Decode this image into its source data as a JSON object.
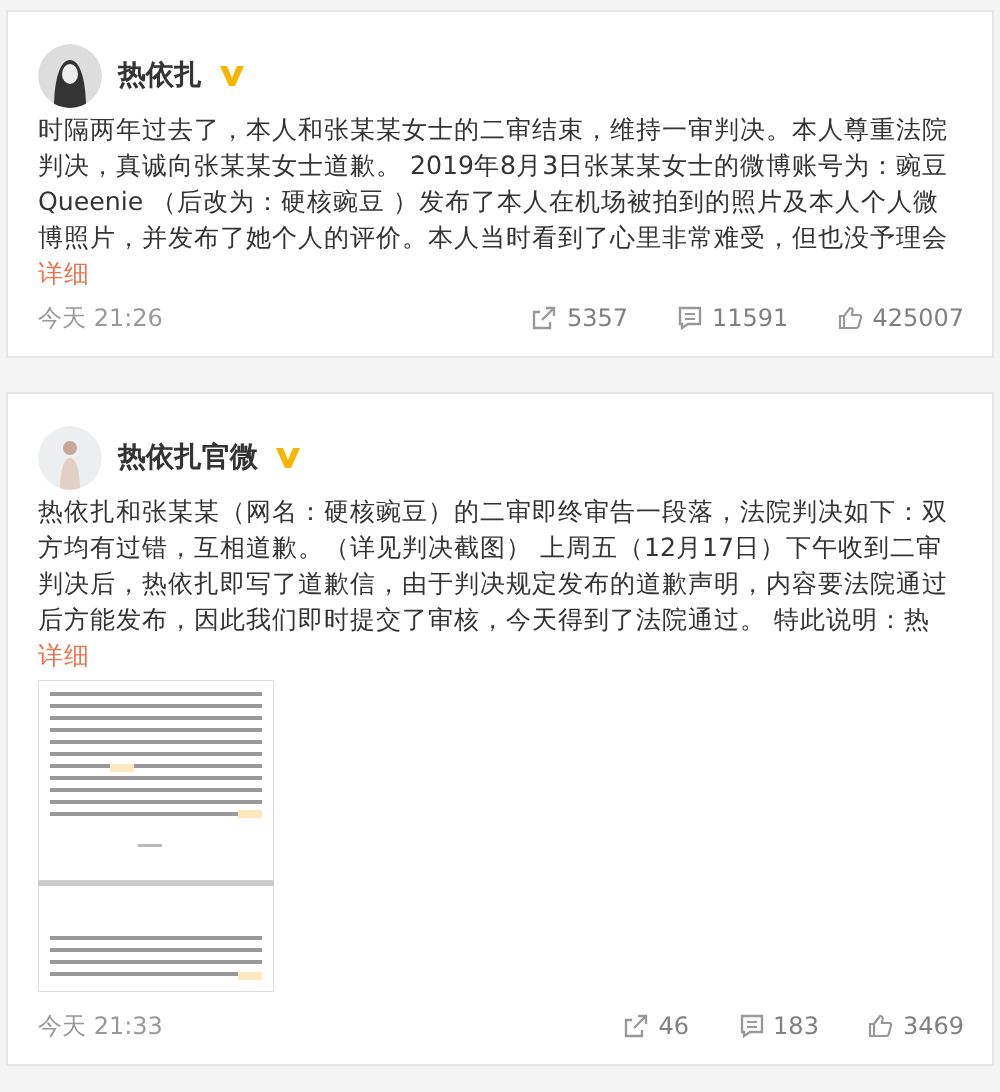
{
  "posts": [
    {
      "author": "热依扎",
      "verified": true,
      "text": "时隔两年过去了，本人和张某某女士的二审结束，维持一审判决。本人尊重法院判决，真诚向张某某女士道歉。 2019年8月3日张某某女士的微博账号为：豌豆Queenie （后改为：硬核豌豆 ）发布了本人在机场被拍到的照片及本人个人微博照片，并发布了她个人的评价。本人当时看到了心里非常难受，但也没予理会",
      "more": "详细",
      "time": "今天 21:26",
      "reposts": "5357",
      "comments": "11591",
      "likes": "425007"
    },
    {
      "author": "热依扎官微",
      "verified": true,
      "text": "热依扎和张某某（网名：硬核豌豆）的二审即终审告一段落，法院判决如下：双方均有过错，互相道歉。（详见判决截图） 上周五（12月17日）下午收到二审判决后，热依扎即写了道歉信，由于判决规定发布的道歉声明，内容要法院通过后方能发布，因此我们即时提交了审核，今天得到了法院通过。 特此说明：热",
      "more": "详细",
      "time": "今天 21:33",
      "reposts": "46",
      "comments": "183",
      "likes": "3469"
    }
  ]
}
